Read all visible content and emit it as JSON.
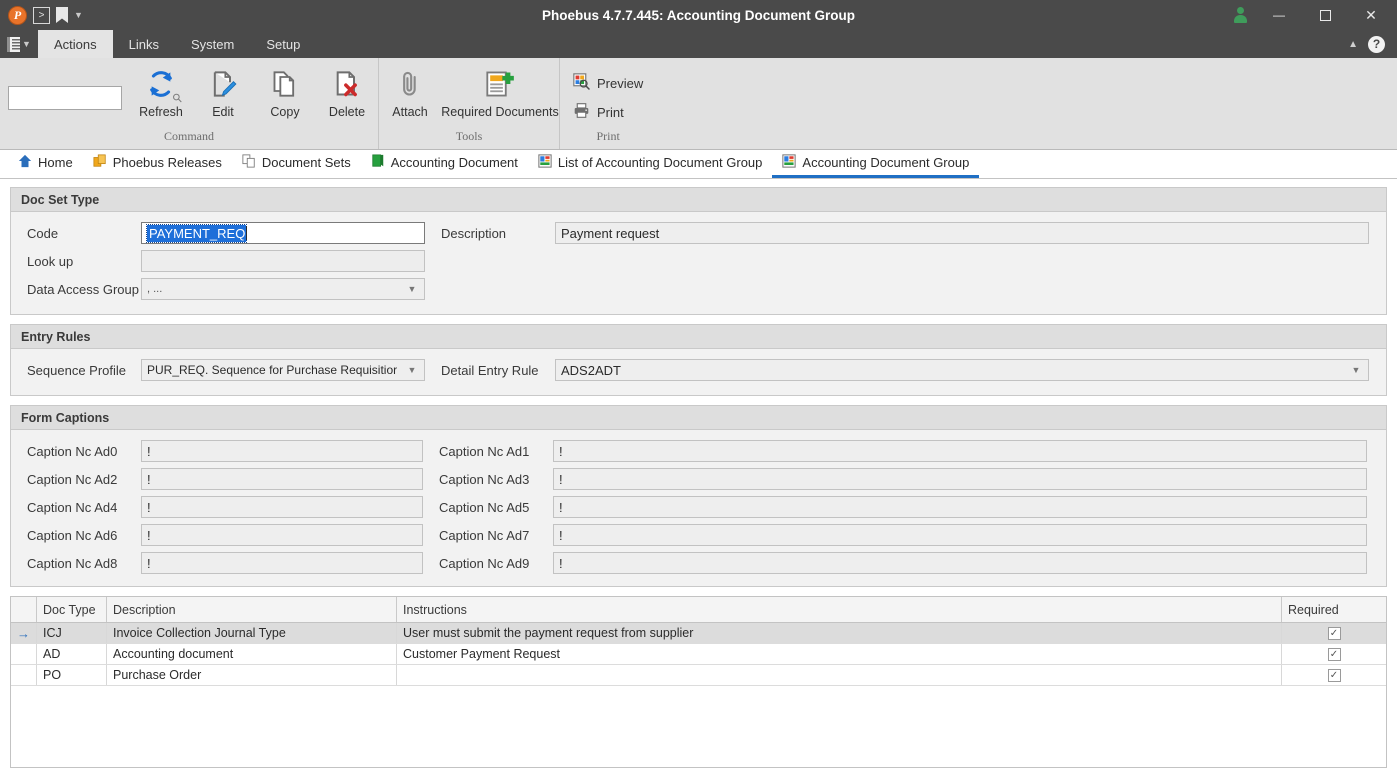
{
  "titlebar": {
    "app_logo": "phoebus-logo-icon",
    "title": "Phoebus 4.7.7.445: Accounting Document Group",
    "buttons": {
      "minimize": "minimize-button",
      "maximize": "maximize-button",
      "close": "close-button"
    }
  },
  "menubar": {
    "items": [
      {
        "label": "Actions",
        "active": true
      },
      {
        "label": "Links",
        "active": false
      },
      {
        "label": "System",
        "active": false
      },
      {
        "label": "Setup",
        "active": false
      }
    ],
    "help_label": "?"
  },
  "ribbon": {
    "search": {
      "value": "",
      "placeholder": ""
    },
    "groups": [
      {
        "caption": "Command",
        "buttons": [
          {
            "label": "Refresh",
            "icon": "refresh-icon"
          },
          {
            "label": "Edit",
            "icon": "edit-pencil-icon"
          },
          {
            "label": "Copy",
            "icon": "copy-icon"
          },
          {
            "label": "Delete",
            "icon": "delete-icon"
          }
        ]
      },
      {
        "caption": "Tools",
        "buttons": [
          {
            "label": "Attach",
            "icon": "paperclip-icon"
          },
          {
            "label": "Required Documents",
            "icon": "required-documents-icon"
          }
        ]
      },
      {
        "caption": "Print",
        "buttons": [
          {
            "label": "Preview",
            "icon": "preview-icon"
          },
          {
            "label": "Print",
            "icon": "printer-icon"
          }
        ]
      }
    ]
  },
  "tabs": [
    {
      "label": "Home",
      "icon": "home-icon",
      "active": false
    },
    {
      "label": "Phoebus Releases",
      "icon": "releases-icon",
      "active": false
    },
    {
      "label": "Document Sets",
      "icon": "document-sets-icon",
      "active": false
    },
    {
      "label": "Accounting Document",
      "icon": "accounting-document-icon",
      "active": false
    },
    {
      "label": "List of Accounting Document Group",
      "icon": "list-grid-icon",
      "active": false
    },
    {
      "label": "Accounting Document Group",
      "icon": "list-grid-icon",
      "active": true
    }
  ],
  "doc_set_type": {
    "title": "Doc Set Type",
    "code": {
      "label": "Code",
      "value": "PAYMENT_REQ",
      "selected": true
    },
    "description": {
      "label": "Description",
      "value": "Payment request"
    },
    "look_up": {
      "label": "Look up",
      "value": ""
    },
    "data_access_group": {
      "label": "Data Access Group",
      "value": ", ..."
    }
  },
  "entry_rules": {
    "title": "Entry Rules",
    "sequence_profile": {
      "label": "Sequence Profile",
      "value": "PUR_REQ. Sequence for Purchase Requisitior"
    },
    "detail_entry_rule": {
      "label": "Detail Entry Rule",
      "value": "ADS2ADT"
    }
  },
  "form_captions": {
    "title": "Form Captions",
    "fields": [
      {
        "label": "Caption Nc Ad0",
        "value": "!"
      },
      {
        "label": "Caption Nc Ad1",
        "value": "!"
      },
      {
        "label": "Caption Nc Ad2",
        "value": "!"
      },
      {
        "label": "Caption Nc Ad3",
        "value": "!"
      },
      {
        "label": "Caption Nc Ad4",
        "value": "!"
      },
      {
        "label": "Caption Nc Ad5",
        "value": "!"
      },
      {
        "label": "Caption Nc Ad6",
        "value": "!"
      },
      {
        "label": "Caption Nc Ad7",
        "value": "!"
      },
      {
        "label": "Caption Nc Ad8",
        "value": "!"
      },
      {
        "label": "Caption Nc Ad9",
        "value": "!"
      }
    ]
  },
  "grid": {
    "columns": [
      "Doc Type",
      "Description",
      "Instructions",
      "Required"
    ],
    "rows": [
      {
        "indicator": "→",
        "doc_type": "ICJ",
        "description": "Invoice Collection Journal Type",
        "instructions": "User must submit the payment request from supplier",
        "required": true,
        "selected": true
      },
      {
        "indicator": "",
        "doc_type": "AD",
        "description": "Accounting document",
        "instructions": "Customer Payment Request",
        "required": true,
        "selected": false
      },
      {
        "indicator": "",
        "doc_type": "PO",
        "description": "Purchase Order",
        "instructions": "",
        "required": true,
        "selected": false
      }
    ],
    "check_glyph": "✓"
  },
  "colors": {
    "titlebar_bg": "#4a4a4a",
    "ribbon_bg": "#e1e1e1",
    "panel_head_bg": "#dedede",
    "accent_blue": "#1f6fc4",
    "selection_blue": "#1e6fd9",
    "user_green": "#3f9c5b",
    "delete_red": "#cc2b2b"
  }
}
